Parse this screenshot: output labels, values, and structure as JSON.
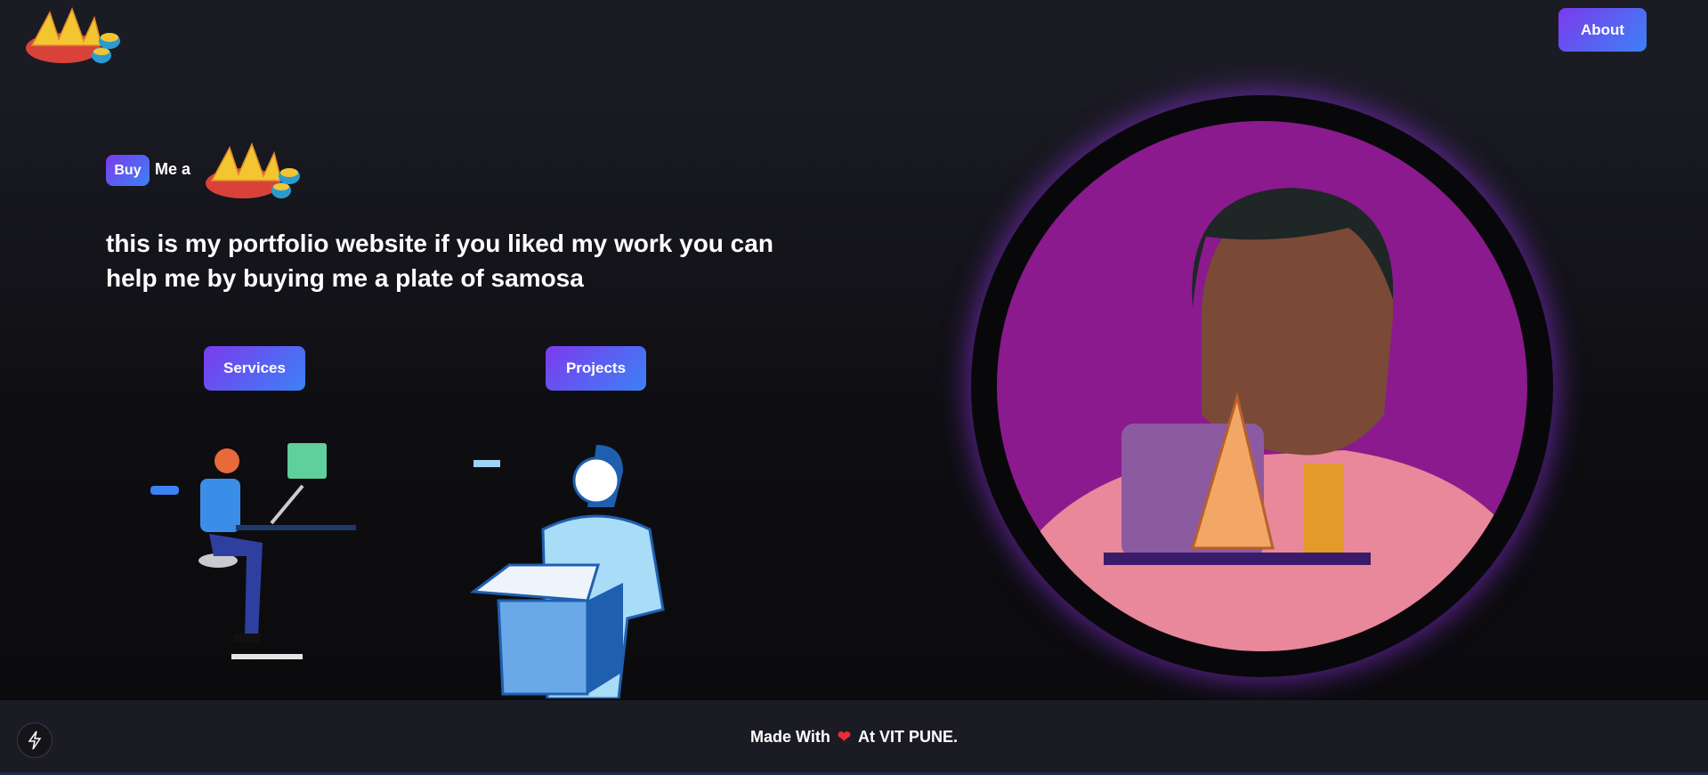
{
  "header": {
    "about_label": "About",
    "logo_icon": "samosa-plate-icon"
  },
  "hero": {
    "buy_label": "Buy",
    "me_a": "Me a",
    "headline": "this is my portfolio website if you liked my work you can help me by buying me a plate of samosa",
    "services_label": "Services",
    "projects_label": "Projects"
  },
  "footer": {
    "made_with": "Made With",
    "heart": "❤",
    "location": "At VIT PUNE.",
    "bolt_icon": "lightning-icon"
  },
  "colors": {
    "accent_start": "#7c3aed",
    "accent_end": "#3b82f6",
    "portrait_bg": "#8b1a8e"
  }
}
